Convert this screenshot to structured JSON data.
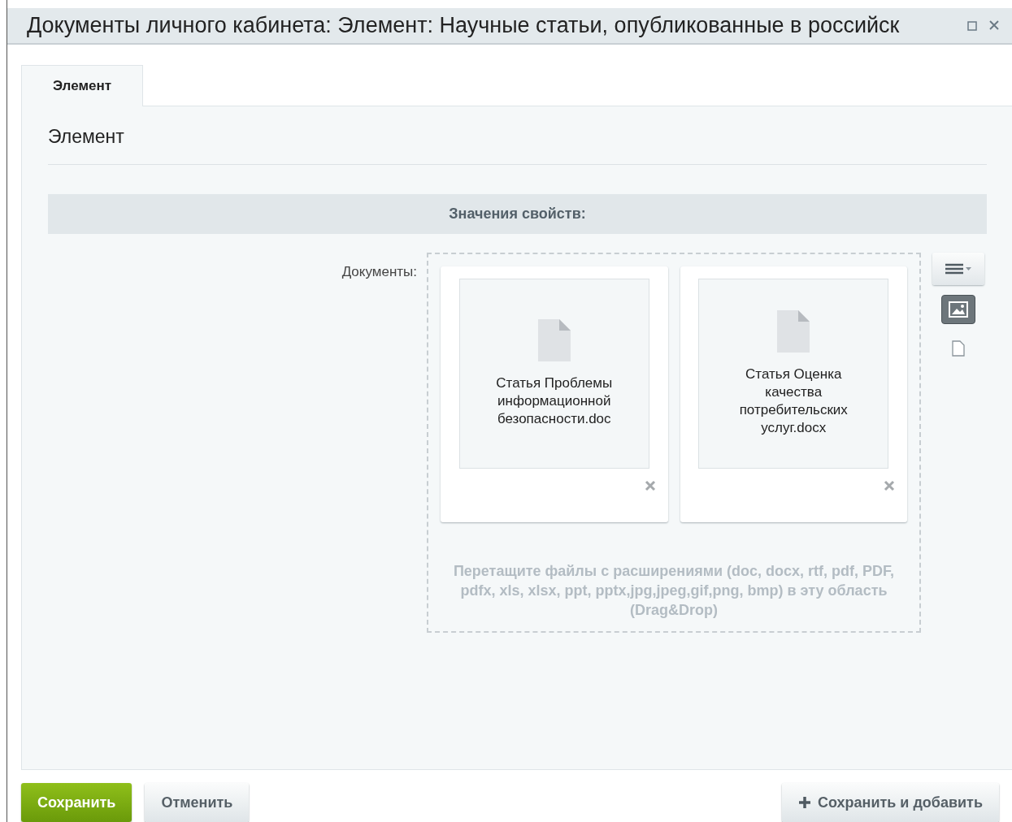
{
  "window": {
    "title": "Документы личного кабинета: Элемент: Научные статьи, опубликованные в российск"
  },
  "tabs": [
    {
      "label": "Элемент",
      "selected": true
    }
  ],
  "section": {
    "heading": "Элемент",
    "properties_header": "Значения свойств:"
  },
  "field": {
    "label": "Документы:",
    "files": [
      {
        "name": "Статья Проблемы информационной безопасности.doc"
      },
      {
        "name": "Статья Оценка качества потребительских услуг.docx"
      }
    ],
    "drop_hint": "Перетащите файлы с расширениями (doc, docx, rtf, pdf, PDF, pdfx, xls, xlsx, ppt, pptx,jpg,jpeg,gif,png, bmp) в эту область (Drag&Drop)",
    "view_modes": [
      {
        "kind": "image",
        "selected": true
      },
      {
        "kind": "file",
        "selected": false
      }
    ]
  },
  "buttons": [
    {
      "kind": "primary",
      "label": "Сохранить"
    },
    {
      "kind": "plain",
      "label": "Отменить"
    },
    {
      "kind": "add",
      "label": "Сохранить и добавить"
    }
  ]
}
